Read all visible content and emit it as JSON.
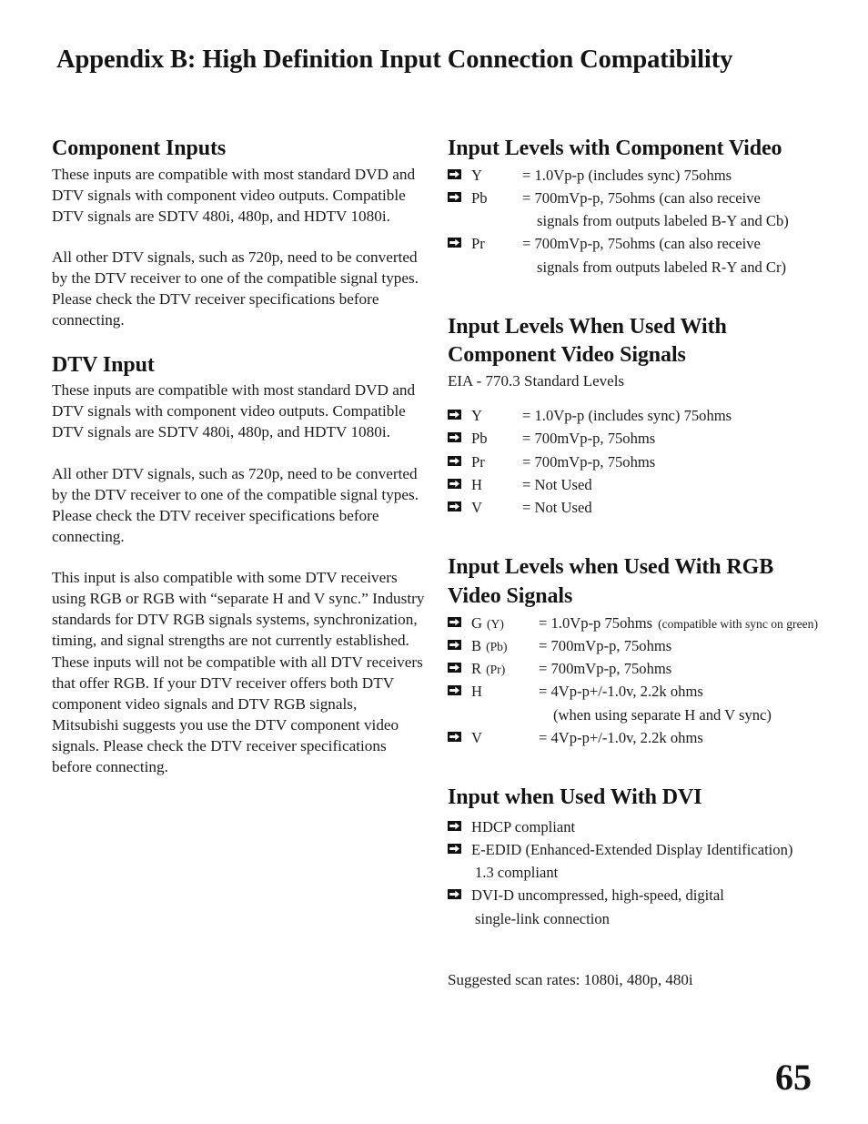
{
  "document": {
    "title": "Appendix B: High Definition Input Connection Compatibility",
    "page_number": "65"
  },
  "left_column": {
    "sections": [
      {
        "heading": "Component Inputs",
        "paragraphs": [
          "These inputs are compatible with most standard DVD and DTV signals with component video outputs. Compatible DTV signals are SDTV 480i, 480p, and HDTV 1080i.",
          "All other DTV signals, such as 720p, need to be converted by the DTV receiver to one of the compatible signal types.  Please check the DTV receiver specifications before connecting."
        ]
      },
      {
        "heading": "DTV Input",
        "paragraphs": [
          "These inputs are compatible with most standard DVD and DTV signals with component video outputs. Compatible DTV signals are SDTV 480i, 480p, and HDTV 1080i.",
          "All other DTV signals, such as 720p, need to be converted by the DTV receiver to one of the compatible signal types.  Please check the DTV receiver specifications before connecting.",
          "This input is also compatible with some DTV receivers using RGB or RGB with “separate H and V sync.” Industry standards for DTV RGB signals systems, synchronization, timing, and signal strengths are not currently established.  These inputs will not be compatible with all DTV receivers that offer RGB.  If your DTV receiver offers both DTV component video signals and DTV RGB signals, Mitsubishi suggests you use the DTV component video signals.  Please check the DTV receiver specifications before connecting."
        ]
      }
    ]
  },
  "right_column": {
    "component_video": {
      "heading": "Input Levels with Component Video",
      "items": [
        {
          "key": "Y",
          "value": "= 1.0Vp-p (includes sync) 75ohms",
          "continuation": ""
        },
        {
          "key": "Pb",
          "value": "= 700mVp-p, 75ohms (can also receive",
          "continuation": "signals from outputs labeled B-Y and Cb)"
        },
        {
          "key": "Pr",
          "value": "= 700mVp-p, 75ohms (can also receive",
          "continuation": "signals from outputs labeled R-Y and Cr)"
        }
      ]
    },
    "component_signals": {
      "heading": "Input Levels When Used With Component Video Signals",
      "subnote": "EIA - 770.3 Standard Levels",
      "items": [
        {
          "key": "Y",
          "value": "= 1.0Vp-p (includes sync) 75ohms"
        },
        {
          "key": "Pb",
          "value": "= 700mVp-p,  75ohms"
        },
        {
          "key": "Pr",
          "value": "= 700mVp-p, 75ohms"
        },
        {
          "key": "H",
          "value": "= Not Used"
        },
        {
          "key": "V",
          "value": "= Not Used"
        }
      ]
    },
    "rgb_signals": {
      "heading": "Input Levels when Used With RGB Video Signals",
      "items": [
        {
          "key_main": "G",
          "key_paren": "(Y)",
          "value": "= 1.0Vp-p 75ohms",
          "value_small": "(compatible with sync on green)",
          "continuation": ""
        },
        {
          "key_main": "B",
          "key_paren": "(Pb)",
          "value": "= 700mVp-p,  75ohms",
          "value_small": "",
          "continuation": ""
        },
        {
          "key_main": "R",
          "key_paren": "(Pr)",
          "value": "= 700mVp-p, 75ohms",
          "value_small": "",
          "continuation": ""
        },
        {
          "key_main": "H",
          "key_paren": "",
          "value": "= 4Vp-p+/-1.0v, 2.2k ohms",
          "value_small": "",
          "continuation": "(when using separate H and V sync)"
        },
        {
          "key_main": "V",
          "key_paren": "",
          "value": "= 4Vp-p+/-1.0v, 2.2k ohms",
          "value_small": "",
          "continuation": ""
        }
      ]
    },
    "dvi": {
      "heading": "Input when Used With DVI",
      "items": [
        {
          "text": "HDCP compliant",
          "continuation": ""
        },
        {
          "text": "E-EDID (Enhanced-Extended Display Identification)",
          "continuation": "1.3 compliant"
        },
        {
          "text": "DVI-D uncompressed, high-speed, digital",
          "continuation": "single-link connection"
        }
      ],
      "scan_note": "Suggested scan rates: 1080i, 480p, 480i"
    }
  }
}
